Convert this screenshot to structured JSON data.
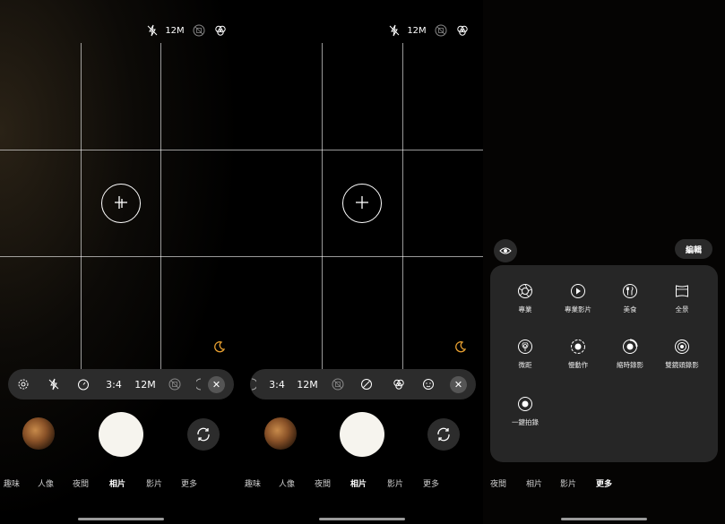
{
  "screens": [
    {
      "topbar": {
        "resolution": "12M"
      },
      "toolbar": {
        "ratio": "3:4",
        "resolution": "12M",
        "close": "✕"
      },
      "modes": [
        "趣味",
        "人像",
        "夜間",
        "相片",
        "影片",
        "更多"
      ],
      "active_mode": "相片"
    },
    {
      "topbar": {
        "resolution": "12M"
      },
      "toolbar": {
        "ratio": "3:4",
        "resolution": "12M",
        "close": "✕"
      },
      "modes": [
        "趣味",
        "人像",
        "夜間",
        "相片",
        "影片",
        "更多"
      ],
      "active_mode": "相片"
    },
    {
      "edit_label": "編輯",
      "more_items": [
        {
          "label": "專業",
          "icon": "aperture-icon"
        },
        {
          "label": "專業影片",
          "icon": "play-circle-icon"
        },
        {
          "label": "美食",
          "icon": "utensils-icon"
        },
        {
          "label": "全景",
          "icon": "panorama-icon"
        },
        {
          "label": "微距",
          "icon": "flower-icon"
        },
        {
          "label": "慢動作",
          "icon": "slow-motion-icon"
        },
        {
          "label": "縮時錄影",
          "icon": "timelapse-icon"
        },
        {
          "label": "雙鏡頭錄影",
          "icon": "dual-record-icon"
        },
        {
          "label": "一鍵拍錄",
          "icon": "single-take-icon"
        }
      ],
      "modes": [
        "夜間",
        "相片",
        "影片",
        "更多"
      ],
      "active_mode": "更多"
    }
  ],
  "colors": {
    "accent_moon": "#e8a030",
    "shutter": "#f6f4ee",
    "toolbar_bg": "#2c2c2c",
    "sheet_bg": "#262626"
  }
}
